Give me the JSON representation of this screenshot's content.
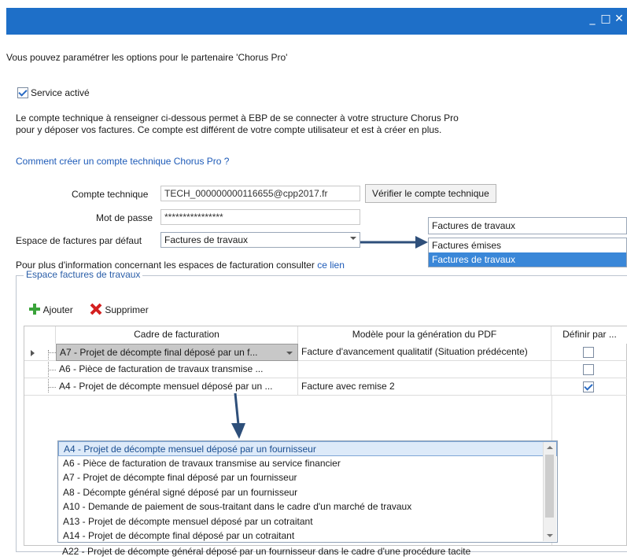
{
  "window": {
    "minimize": "_",
    "maximize": "□",
    "close": "✕"
  },
  "intro": "Vous pouvez paramétrer les options pour le partenaire 'Chorus Pro'",
  "service": {
    "label": "Service activé",
    "checked": true
  },
  "description": {
    "line1": "Le compte technique à renseigner ci-dessous permet à EBP de se connecter à votre structure Chorus Pro",
    "line2": "pour y déposer vos factures. Ce compte est différent de votre compte utilisateur et est à créer en plus."
  },
  "help_link": "Comment créer un compte technique Chorus Pro ?",
  "form": {
    "account_label": "Compte technique",
    "account_value": "TECH_000000000116655@cpp2017.fr",
    "verify_button": "Vérifier le compte technique",
    "password_label": "Mot de passe",
    "password_value": "****************",
    "space_label": "Espace de factures par défaut",
    "space_value": "Factures de travaux"
  },
  "info": {
    "text": "Pour plus d'information concernant les espaces de facturation consulter ",
    "link": "ce lien"
  },
  "popup": {
    "current": "Factures de travaux",
    "options": [
      "Factures émises",
      "Factures de travaux"
    ],
    "selected_index": 1
  },
  "group": {
    "title": "Espace factures de travaux",
    "add_label": "Ajouter",
    "delete_label": "Supprimer"
  },
  "grid": {
    "columns": [
      "Cadre de facturation",
      "Modèle pour la génération du PDF",
      "Définir par ..."
    ],
    "rows": [
      {
        "cadre": "A7 - Projet de décompte final déposé par un f...",
        "modele": "Facture d'avancement qualitatif (Situation prédécente)",
        "defaut": false,
        "current": true
      },
      {
        "cadre": "A6 - Pièce de facturation de travaux transmise ...",
        "modele": "",
        "defaut": false,
        "current": false
      },
      {
        "cadre": "A4 - Projet de décompte mensuel déposé par un ...",
        "modele": "Facture avec remise 2",
        "defaut": true,
        "current": false
      }
    ]
  },
  "cadre_list": {
    "items": [
      "A4 - Projet de décompte mensuel déposé par un fournisseur",
      "A6 - Pièce de facturation de travaux transmise  au service financier",
      "A7 - Projet de décompte final déposé par un fournisseur",
      "A8 - Décompte général signé déposé par un fournisseur",
      "A10 - Demande de paiement de sous-traitant dans le cadre d'un marché de travaux",
      "A13 - Projet de décompte mensuel déposé par un cotraitant",
      "A14 - Projet de décompte final déposé par un cotraitant",
      "A22 - Projet de décompte général déposé par un fournisseur dans le cadre d'une procédure tacite"
    ],
    "selected_index": 0
  },
  "colors": {
    "titlebar": "#1e6fc8",
    "link": "#1e5bb8",
    "arrow": "#2e4f7a",
    "selected": "#3a87d8"
  }
}
